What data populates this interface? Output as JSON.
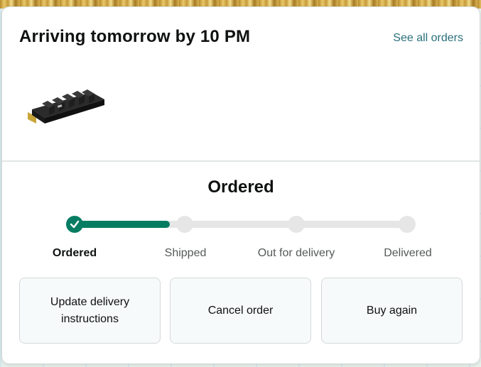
{
  "delivery": {
    "title": "Arriving tomorrow by 10 PM",
    "see_all_label": "See all orders"
  },
  "progress": {
    "status_title": "Ordered",
    "fraction_complete": 0.33,
    "steps": [
      {
        "label": "Ordered",
        "state": "complete"
      },
      {
        "label": "Shipped",
        "state": "pending"
      },
      {
        "label": "Out for delivery",
        "state": "pending"
      },
      {
        "label": "Delivered",
        "state": "pending"
      }
    ]
  },
  "actions": {
    "update_label": "Update delivery instructions",
    "cancel_label": "Cancel order",
    "buy_again_label": "Buy again"
  },
  "colors": {
    "accent": "#067d62",
    "link": "#2a6f7a"
  }
}
